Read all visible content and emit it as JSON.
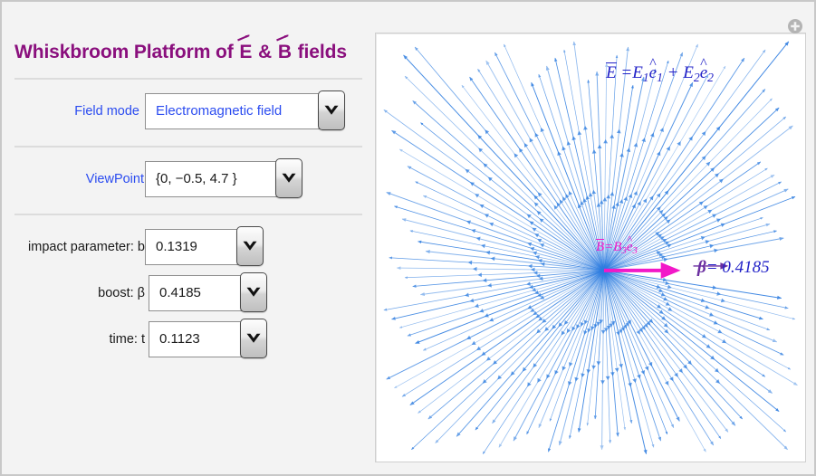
{
  "app": {
    "title_prefix": "Whiskbroom Platform of ",
    "title_e": "E",
    "title_amp": " & ",
    "title_b": "B",
    "title_suffix": " fields",
    "accent_color": "#8a0f7d",
    "panel_bg": "#f3f3f3"
  },
  "controls": [
    {
      "name": "field-mode",
      "label": "Field mode",
      "label_color": "blue",
      "value": "Electromagnetic field",
      "value_color": "blue",
      "options": [
        "Electromagnetic field"
      ]
    },
    {
      "name": "viewpoint",
      "label": "ViewPoint",
      "label_color": "blue",
      "value": "{0, −0.5, 4.7 }",
      "value_color": "black",
      "options": [
        "{0, −0.5, 4.7 }"
      ]
    },
    {
      "name": "impact-parameter",
      "label": "impact parameter: b",
      "label_color": "black",
      "value": "0.1319",
      "value_color": "black",
      "options": [
        "0.1319"
      ]
    },
    {
      "name": "boost-beta",
      "label": "boost: β",
      "label_color": "black",
      "value": "0.4185",
      "value_color": "black",
      "options": [
        "0.4185"
      ]
    },
    {
      "name": "time-t",
      "label": "time:  t",
      "label_color": "black",
      "value": "0.1123",
      "value_color": "black",
      "options": [
        "0.1123"
      ]
    }
  ],
  "graphic": {
    "name": "field-line-plot",
    "annotations": {
      "e_field": {
        "vector": "E",
        "equals": " =",
        "term1_coef": "E",
        "term1_sub": "1",
        "term1_unit": "e",
        "term1_unit_sub": "1",
        "plus": " + ",
        "term2_coef": "E",
        "term2_sub": "2",
        "term2_unit": "e",
        "term2_unit_sub": "2",
        "color": "#2323c8"
      },
      "b_field": {
        "vector": "B",
        "equals": "=",
        "coef": "B",
        "coef_sub": "3",
        "unit": "e",
        "unit_sub": "3",
        "color": "#f218c8"
      },
      "beta": {
        "symbol": "β",
        "equals": "= ",
        "value": "0.4185",
        "symbol_color": "#6a2fa0",
        "value_color": "#2323c8"
      }
    },
    "field_line_color": "#2e7de0",
    "boost_arrow_color": "#f218c8",
    "beta_arrow_color": "#6a2fa0"
  },
  "window": {
    "expand_button": "expand-plus-icon"
  }
}
